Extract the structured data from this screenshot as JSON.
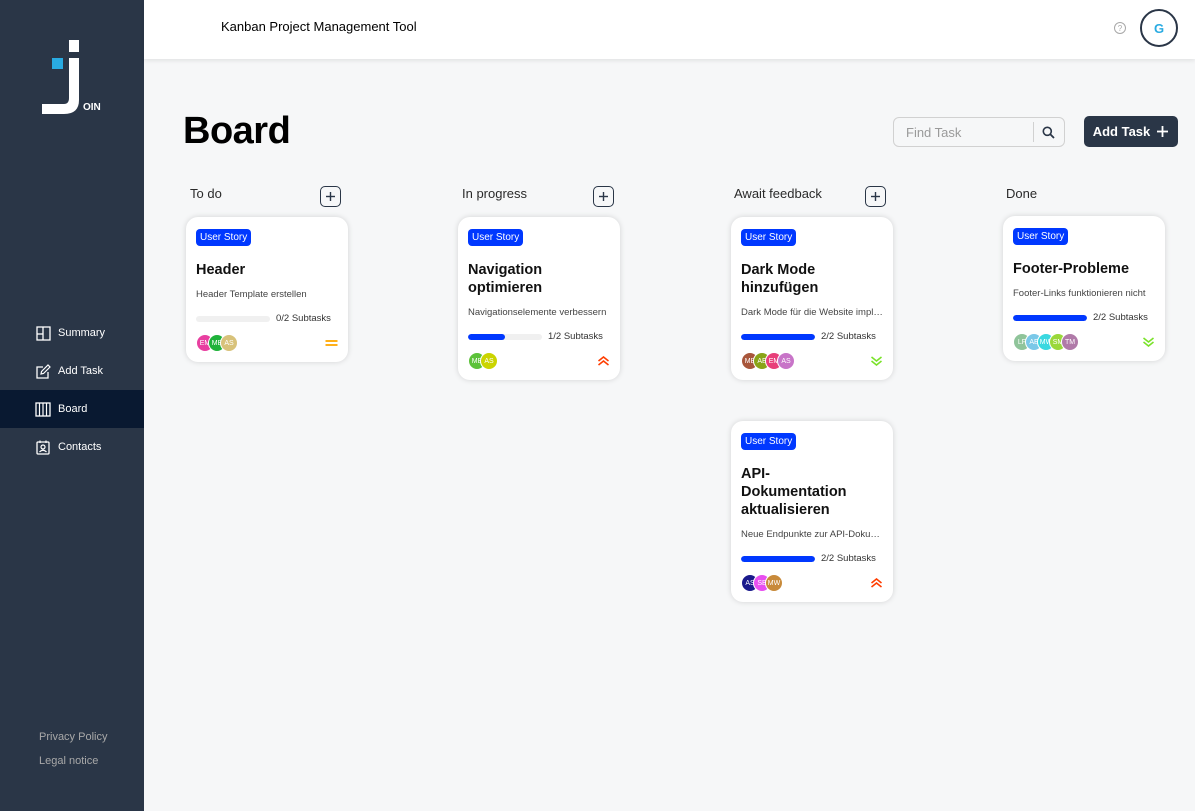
{
  "app": {
    "title": "Kanban Project Management Tool",
    "logo_text": "OIN",
    "logo_letter": "J",
    "user_initial": "G",
    "help": "?"
  },
  "nav": [
    {
      "label": "Summary",
      "icon": "summary-icon",
      "active": false
    },
    {
      "label": "Add Task",
      "icon": "add-task-icon",
      "active": false
    },
    {
      "label": "Board",
      "icon": "board-icon",
      "active": true
    },
    {
      "label": "Contacts",
      "icon": "contacts-icon",
      "active": false
    }
  ],
  "footer": {
    "privacy": "Privacy Policy",
    "legal": "Legal notice"
  },
  "board": {
    "title": "Board",
    "search_placeholder": "Find Task",
    "add_label": "Add Task"
  },
  "columns": [
    {
      "label": "To do",
      "has_add": true
    },
    {
      "label": "In progress",
      "has_add": true
    },
    {
      "label": "Await feedback",
      "has_add": true
    },
    {
      "label": "Done",
      "has_add": false
    }
  ],
  "colors": {
    "sidebar": "#2a3647",
    "badge": "#0038ff",
    "accent": "#29abe2",
    "urgent": "#ff3d00",
    "medium": "#ffa800",
    "low": "#7ae229"
  },
  "cards": [
    {
      "column": 0,
      "category": "User Story",
      "title": "Header",
      "description": "Header Template erstellen",
      "subtasks": "0/2 Subtasks",
      "progress": 0,
      "priority": "medium",
      "assignees": [
        {
          "initials": "EM",
          "color": "#e83fa0"
        },
        {
          "initials": "MB",
          "color": "#1fb23a"
        },
        {
          "initials": "AS",
          "color": "#d8c27a"
        }
      ]
    },
    {
      "column": 1,
      "category": "User Story",
      "title": "Navigation optimieren",
      "description": "Navigationselemente verbessern",
      "subtasks": "1/2 Subtasks",
      "progress": 0.5,
      "priority": "urgent",
      "assignees": [
        {
          "initials": "MB",
          "color": "#5cc23a"
        },
        {
          "initials": "AS",
          "color": "#cbd400"
        }
      ]
    },
    {
      "column": 2,
      "category": "User Story",
      "title": "Dark Mode hinzufügen",
      "description": "Dark Mode für die Website implementieren",
      "subtasks": "2/2 Subtasks",
      "progress": 1,
      "priority": "low",
      "assignees": [
        {
          "initials": "MB",
          "color": "#a8563b"
        },
        {
          "initials": "AE",
          "color": "#8aa418"
        },
        {
          "initials": "EM",
          "color": "#e83f7a"
        },
        {
          "initials": "AS",
          "color": "#c874c8"
        }
      ]
    },
    {
      "column": 2,
      "category": "User Story",
      "title": "API-Dokumentation aktualisieren",
      "description": "Neue Endpunkte zur API-Dokumentation",
      "subtasks": "2/2 Subtasks",
      "progress": 1,
      "priority": "urgent",
      "assignees": [
        {
          "initials": "AS",
          "color": "#1a1a8c"
        },
        {
          "initials": "SB",
          "color": "#e84ff0"
        },
        {
          "initials": "MW",
          "color": "#c88a3a"
        }
      ]
    },
    {
      "column": 3,
      "category": "User Story",
      "title": "Footer-Probleme",
      "description": "Footer-Links funktionieren nicht",
      "subtasks": "2/2 Subtasks",
      "progress": 1,
      "priority": "low",
      "assignees": [
        {
          "initials": "LF",
          "color": "#8fc49a"
        },
        {
          "initials": "AE",
          "color": "#7ac8e8"
        },
        {
          "initials": "MW",
          "color": "#3ad8e0"
        },
        {
          "initials": "SM",
          "color": "#9ad83a"
        },
        {
          "initials": "TM",
          "color": "#b07aa8"
        }
      ]
    }
  ]
}
